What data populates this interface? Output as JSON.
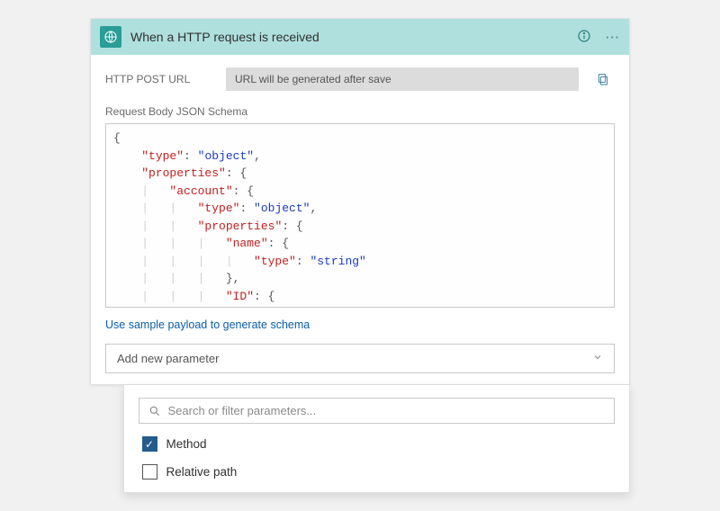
{
  "header": {
    "title": "When a HTTP request is received"
  },
  "url_row": {
    "label": "HTTP POST URL",
    "value": "URL will be generated after save"
  },
  "schema": {
    "label": "Request Body JSON Schema",
    "content": {
      "type": "object",
      "properties": {
        "account": {
          "type": "object",
          "properties": {
            "name": {
              "type": "string"
            },
            "ID": {}
          }
        }
      }
    },
    "tokens": {
      "type_key": "\"type\"",
      "object_val": "\"object\"",
      "properties_key": "\"properties\"",
      "account_key": "\"account\"",
      "name_key": "\"name\"",
      "string_val": "\"string\"",
      "id_key": "\"ID\""
    }
  },
  "sample_link": "Use sample payload to generate schema",
  "add_param": {
    "label": "Add new parameter"
  },
  "dropdown": {
    "search_placeholder": "Search or filter parameters...",
    "options": [
      {
        "key": "method",
        "label": "Method",
        "checked": true
      },
      {
        "key": "relative_path",
        "label": "Relative path",
        "checked": false
      }
    ]
  }
}
